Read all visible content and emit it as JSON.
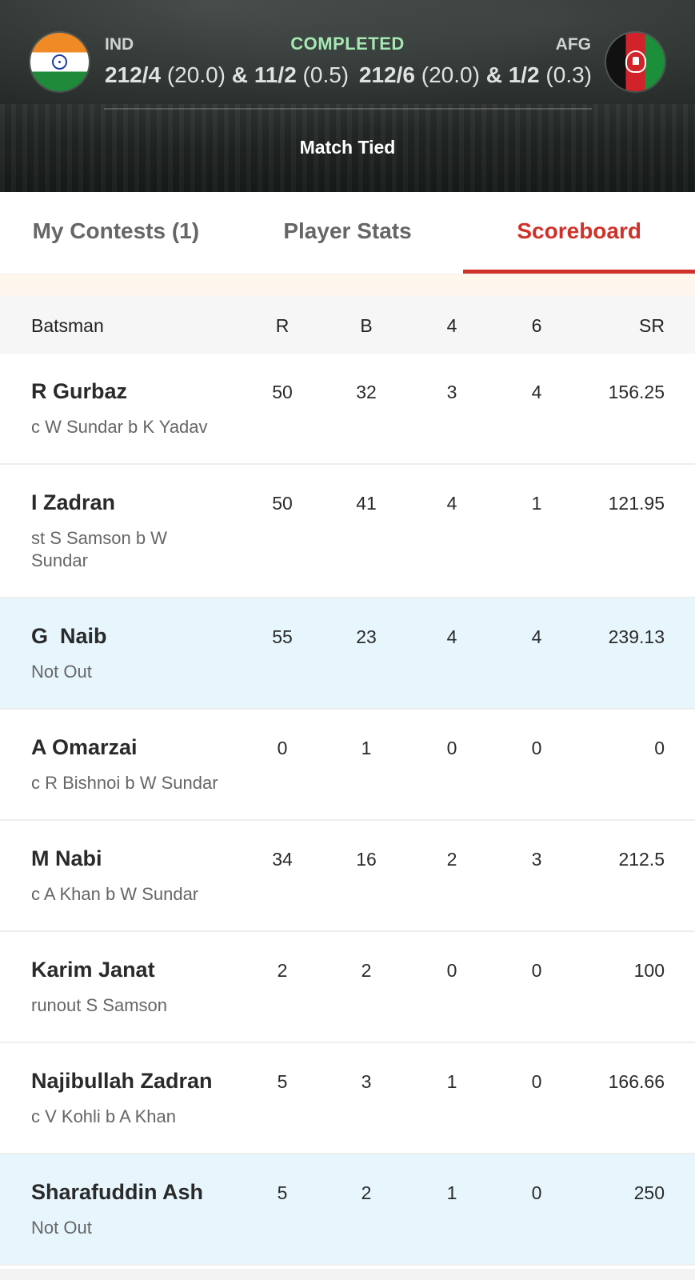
{
  "header": {
    "status": "COMPLETED",
    "result": "Match Tied",
    "team1": {
      "code": "IND",
      "score_main": "212/4",
      "overs_main": "(20.0)",
      "amp": "&",
      "score_super": "11/2",
      "overs_super": "(0.5)",
      "flag_icon": "india-flag-icon"
    },
    "team2": {
      "code": "AFG",
      "score_main": "212/6",
      "overs_main": "(20.0)",
      "amp": "&",
      "score_super": "1/2",
      "overs_super": "(0.3)",
      "flag_icon": "afghanistan-flag-icon"
    },
    "status_color": "#a6e8b4"
  },
  "tabs": [
    {
      "label": "My Contests (1)",
      "active": false
    },
    {
      "label": "Player Stats",
      "active": false
    },
    {
      "label": "Scoreboard",
      "active": true
    }
  ],
  "accent_color": "#d0322a",
  "table": {
    "headers": {
      "name": "Batsman",
      "r": "R",
      "b": "B",
      "fours": "4",
      "sixes": "6",
      "sr": "SR"
    },
    "rows": [
      {
        "name": "R Gurbaz",
        "dismissal": "c W Sundar b K Yadav",
        "r": "50",
        "b": "32",
        "fours": "3",
        "sixes": "4",
        "sr": "156.25",
        "not_out": false
      },
      {
        "name": "I Zadran",
        "dismissal": "st S Samson b W Sundar",
        "r": "50",
        "b": "41",
        "fours": "4",
        "sixes": "1",
        "sr": "121.95",
        "not_out": false
      },
      {
        "name": "G  Naib",
        "dismissal": "Not Out",
        "r": "55",
        "b": "23",
        "fours": "4",
        "sixes": "4",
        "sr": "239.13",
        "not_out": true
      },
      {
        "name": "A Omarzai",
        "dismissal": "c R Bishnoi b W Sundar",
        "r": "0",
        "b": "1",
        "fours": "0",
        "sixes": "0",
        "sr": "0",
        "not_out": false
      },
      {
        "name": "M Nabi",
        "dismissal": "c A Khan b W Sundar",
        "r": "34",
        "b": "16",
        "fours": "2",
        "sixes": "3",
        "sr": "212.5",
        "not_out": false
      },
      {
        "name": "Karim Janat",
        "dismissal": "runout S Samson",
        "r": "2",
        "b": "2",
        "fours": "0",
        "sixes": "0",
        "sr": "100",
        "not_out": false
      },
      {
        "name": "Najibullah Zadran",
        "dismissal": "c V Kohli b A Khan",
        "r": "5",
        "b": "3",
        "fours": "1",
        "sixes": "0",
        "sr": "166.66",
        "not_out": false
      },
      {
        "name": "Sharafuddin Ash",
        "dismissal": "Not Out",
        "r": "5",
        "b": "2",
        "fours": "1",
        "sixes": "0",
        "sr": "250",
        "not_out": true
      }
    ]
  }
}
